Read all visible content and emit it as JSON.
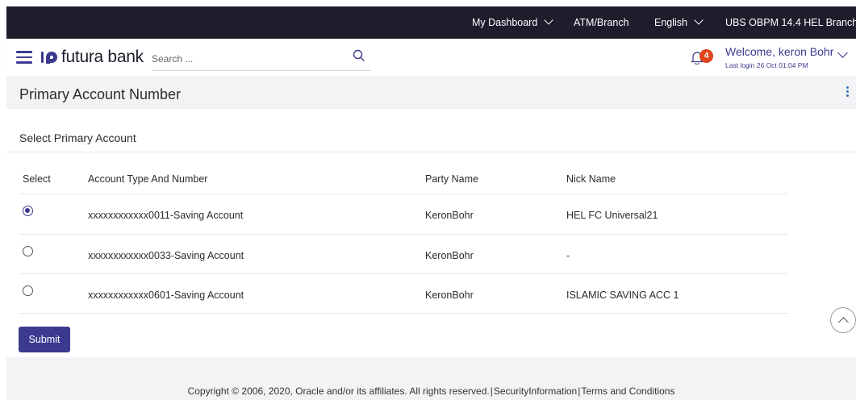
{
  "topbar": {
    "dashboard_label": "My Dashboard",
    "atm_label": "ATM/Branch",
    "language_label": "English",
    "branch_label": "UBS OBPM 14.4 HEL Branch"
  },
  "header": {
    "brand_name": "futura bank",
    "search_placeholder": "Search ...",
    "notification_count": "4",
    "welcome_text": "Welcome, keron Bohr",
    "last_login": "Last login 26 Oct 01:04 PM"
  },
  "page": {
    "title": "Primary Account Number",
    "section_title": "Select Primary Account"
  },
  "table": {
    "headers": {
      "select": "Select",
      "account": "Account Type And Number",
      "party": "Party Name",
      "nick": "Nick Name"
    },
    "rows": [
      {
        "account": "xxxxxxxxxxxx0011-Saving Account",
        "party": "KeronBohr",
        "nick": "HEL FC Universal21",
        "selected": true
      },
      {
        "account": "xxxxxxxxxxxx0033-Saving Account",
        "party": "KeronBohr",
        "nick": "-",
        "selected": false
      },
      {
        "account": "xxxxxxxxxxxx0601-Saving Account",
        "party": "KeronBohr",
        "nick": "ISLAMIC SAVING ACC 1",
        "selected": false
      }
    ]
  },
  "actions": {
    "submit_label": "Submit"
  },
  "footer": {
    "copyright": "Copyright © 2006, 2020, Oracle and/or its affiliates. All rights reserved.",
    "security_link": "SecurityInformation",
    "terms_link": "Terms and Conditions",
    "separator": "|"
  },
  "colors": {
    "topbar_bg": "#1f1c2c",
    "brand_accent": "#3b3a8f",
    "badge": "#e0461f",
    "page_bg": "#f3f3f6"
  },
  "icons": [
    "menu-icon",
    "futura-logo-icon",
    "search-icon",
    "bell-icon",
    "chevron-down-icon",
    "kebab-menu-icon",
    "chevron-up-icon"
  ]
}
